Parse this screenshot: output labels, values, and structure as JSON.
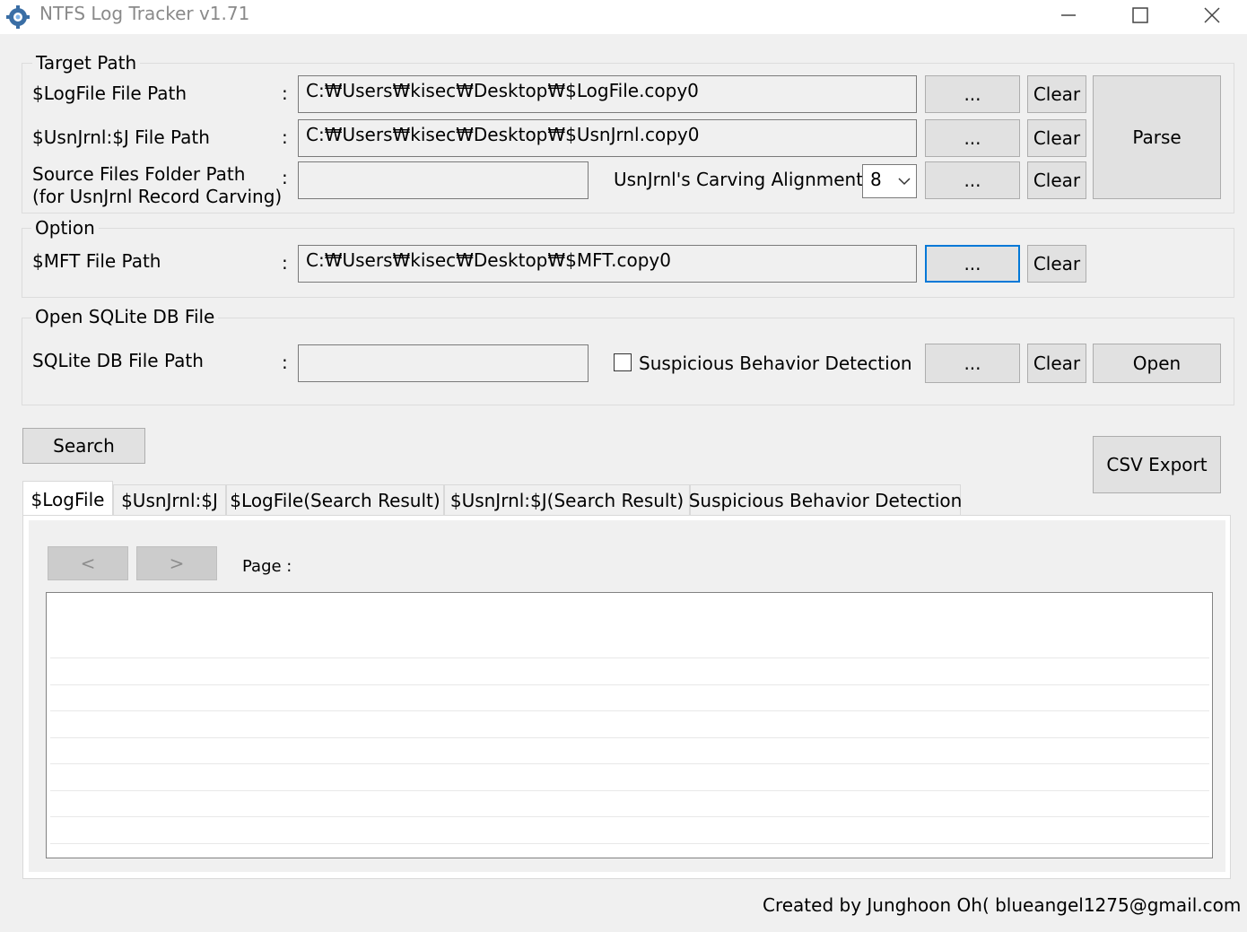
{
  "window": {
    "title": "NTFS Log Tracker v1.71"
  },
  "target_path": {
    "legend": "Target Path",
    "logfile_label": "$LogFile File Path",
    "logfile_value": "C:₩Users₩kisec₩Desktop₩$LogFile.copy0",
    "usnjrnl_label": "$UsnJrnl:$J File Path",
    "usnjrnl_value": "C:₩Users₩kisec₩Desktop₩$UsnJrnl.copy0",
    "source_label_1": "Source Files Folder Path",
    "source_label_2": "(for UsnJrnl Record Carving)",
    "source_value": "",
    "alignment_label": "UsnJrnl's Carving Alignment :",
    "alignment_value": "8",
    "parse_button": "Parse"
  },
  "option": {
    "legend": "Option",
    "mft_label": "$MFT File Path",
    "mft_value": "C:₩Users₩kisec₩Desktop₩$MFT.copy0"
  },
  "sqlite": {
    "legend": "Open SQLite DB File",
    "db_label": "SQLite DB File Path",
    "db_value": "",
    "suspicious_checkbox_label": "Suspicious Behavior Detection",
    "suspicious_checked": false,
    "open_button": "Open"
  },
  "common": {
    "colon": ":",
    "browse_button": "...",
    "clear_button": "Clear"
  },
  "search_button": "Search",
  "csv_export_button": "CSV Export",
  "tabs": [
    {
      "label": "$LogFile"
    },
    {
      "label": "$UsnJrnl:$J"
    },
    {
      "label": "$LogFile(Search Result)"
    },
    {
      "label": "$UsnJrnl:$J(Search Result)"
    },
    {
      "label": "Suspicious Behavior Detection"
    }
  ],
  "pager": {
    "prev": "<",
    "next": ">",
    "page_label": "Page :"
  },
  "footer": "Created by Junghoon Oh( blueangel1275@gmail.com )",
  "colors": {
    "focus": "#0078d7",
    "window_bg": "#f0f0f0"
  }
}
